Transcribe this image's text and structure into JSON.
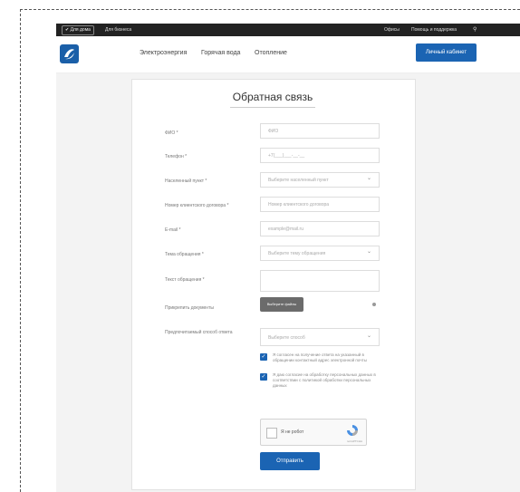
{
  "topbar": {
    "for_home": "Для дома",
    "for_business": "Для бизнеса",
    "offices": "Офисы",
    "notify": "Помощь и поддержка"
  },
  "header": {
    "nav": [
      "Электроэнергия",
      "Горячая вода",
      "Отопление"
    ],
    "cabinet_button": "Личный кабинет"
  },
  "form": {
    "title": "Обратная связь",
    "fio_label": "ФИО *",
    "fio_placeholder": "ФИО",
    "phone_label": "Телефон *",
    "phone_placeholder": "+7(___)___-__-__",
    "city_label": "Населенный пункт *",
    "city_value": "Выберите населенный пункт",
    "contract_label": "Номер клиентского договора *",
    "contract_placeholder": "Номер клиентского договора",
    "email_label": "E-mail *",
    "email_placeholder": "example@mail.ru",
    "type_label": "Тема обращения *",
    "type_value": "Выберите тему обращения",
    "text_label": "Текст обращения *",
    "attach_label": "Прикрепить документы",
    "attach_button": "Выберите файлы",
    "reply_label": "Предпочитаемый способ ответа",
    "reply_value": "Выберите способ",
    "consent1": "Я согласен на получение ответа на указанный в обращении контактный адрес электронной почты",
    "consent2": "Я даю согласие на обработку персональных данных в соответствии с политикой обработки персональных данных",
    "captcha_label": "Я не робот",
    "captcha_brand": "reCAPTCHA",
    "submit": "Отправить"
  }
}
